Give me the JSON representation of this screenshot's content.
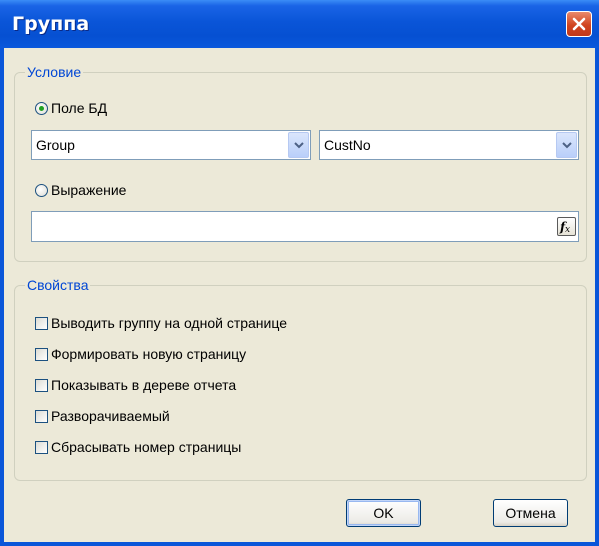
{
  "window": {
    "title": "Группа",
    "close_icon": "close-icon"
  },
  "condition": {
    "legend": "Условие",
    "db_field_label": "Поле БД",
    "db_field_selected": true,
    "dataset_value": "Group",
    "field_value": "CustNo",
    "expression_label": "Выражение",
    "expression_selected": false,
    "expression_value": "",
    "fx_icon": "fx-icon"
  },
  "properties": {
    "legend": "Свойства",
    "items": [
      {
        "label": "Выводить группу на одной странице",
        "checked": false
      },
      {
        "label": "Формировать новую страницу",
        "checked": false
      },
      {
        "label": "Показывать в дереве отчета",
        "checked": false
      },
      {
        "label": "Разворачиваемый",
        "checked": false
      },
      {
        "label": "Сбрасывать номер страницы",
        "checked": false
      }
    ]
  },
  "buttons": {
    "ok": "OK",
    "cancel": "Отмена"
  },
  "colors": {
    "titlebar": "#0a56d9",
    "legend_text": "#0046d5",
    "dialog_bg": "#ece9d8"
  }
}
